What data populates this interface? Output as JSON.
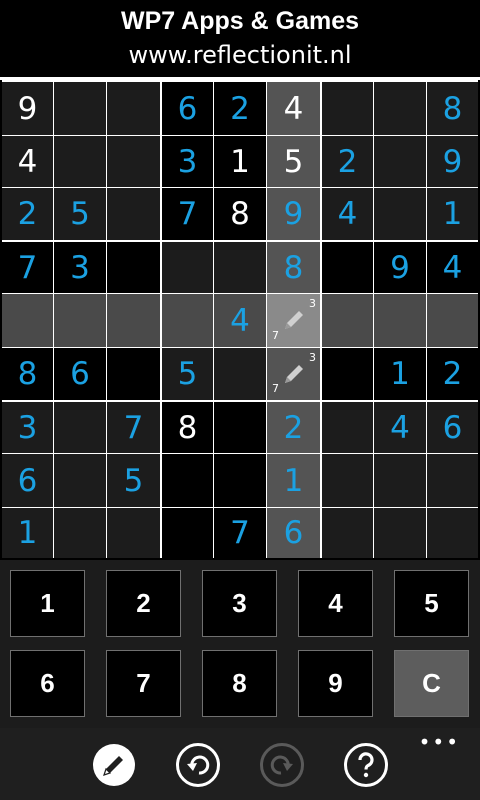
{
  "header": {
    "title": "WP7 Apps & Games",
    "subtitle": "www.reflectionit.nl"
  },
  "colors": {
    "given_digit": "#ffffff",
    "entered_digit": "#1ba1e2",
    "cell_default": "#1c1c1c",
    "cell_black": "#000000",
    "highlight_row": "#4a4a4a",
    "highlight_col": "#545454",
    "selected_cell": "#8a8a8a",
    "keypad_bg": "#1c1c1c",
    "appbar_bg": "#1f1f1f"
  },
  "board": {
    "selected": {
      "row": 4,
      "col": 5
    },
    "rows": [
      [
        {
          "v": "9",
          "t": "given"
        },
        {
          "v": "",
          "t": ""
        },
        {
          "v": "",
          "t": ""
        },
        {
          "v": "6",
          "t": "entered"
        },
        {
          "v": "2",
          "t": "entered"
        },
        {
          "v": "4",
          "t": "given"
        },
        {
          "v": "",
          "t": ""
        },
        {
          "v": "",
          "t": ""
        },
        {
          "v": "8",
          "t": "entered"
        }
      ],
      [
        {
          "v": "4",
          "t": "given"
        },
        {
          "v": "",
          "t": ""
        },
        {
          "v": "",
          "t": ""
        },
        {
          "v": "3",
          "t": "entered"
        },
        {
          "v": "1",
          "t": "given"
        },
        {
          "v": "5",
          "t": "given"
        },
        {
          "v": "2",
          "t": "entered"
        },
        {
          "v": "",
          "t": ""
        },
        {
          "v": "9",
          "t": "entered"
        }
      ],
      [
        {
          "v": "2",
          "t": "entered"
        },
        {
          "v": "5",
          "t": "entered"
        },
        {
          "v": "",
          "t": ""
        },
        {
          "v": "7",
          "t": "entered"
        },
        {
          "v": "8",
          "t": "given"
        },
        {
          "v": "9",
          "t": "entered"
        },
        {
          "v": "4",
          "t": "entered"
        },
        {
          "v": "",
          "t": ""
        },
        {
          "v": "1",
          "t": "entered"
        }
      ],
      [
        {
          "v": "7",
          "t": "entered"
        },
        {
          "v": "3",
          "t": "entered"
        },
        {
          "v": "",
          "t": ""
        },
        {
          "v": "",
          "t": ""
        },
        {
          "v": "",
          "t": ""
        },
        {
          "v": "8",
          "t": "entered"
        },
        {
          "v": "",
          "t": ""
        },
        {
          "v": "9",
          "t": "entered"
        },
        {
          "v": "4",
          "t": "entered"
        }
      ],
      [
        {
          "v": "",
          "t": ""
        },
        {
          "v": "",
          "t": ""
        },
        {
          "v": "",
          "t": ""
        },
        {
          "v": "",
          "t": ""
        },
        {
          "v": "4",
          "t": "entered"
        },
        {
          "v": "",
          "t": "notes",
          "notes": [
            "3",
            "7"
          ]
        },
        {
          "v": "",
          "t": ""
        },
        {
          "v": "",
          "t": ""
        },
        {
          "v": "",
          "t": ""
        }
      ],
      [
        {
          "v": "8",
          "t": "entered"
        },
        {
          "v": "6",
          "t": "entered"
        },
        {
          "v": "",
          "t": ""
        },
        {
          "v": "5",
          "t": "entered"
        },
        {
          "v": "",
          "t": ""
        },
        {
          "v": "",
          "t": "notes",
          "notes": [
            "3",
            "7"
          ]
        },
        {
          "v": "",
          "t": ""
        },
        {
          "v": "1",
          "t": "entered"
        },
        {
          "v": "2",
          "t": "entered"
        }
      ],
      [
        {
          "v": "3",
          "t": "entered"
        },
        {
          "v": "",
          "t": ""
        },
        {
          "v": "7",
          "t": "entered"
        },
        {
          "v": "8",
          "t": "given"
        },
        {
          "v": "",
          "t": ""
        },
        {
          "v": "2",
          "t": "entered"
        },
        {
          "v": "",
          "t": ""
        },
        {
          "v": "4",
          "t": "entered"
        },
        {
          "v": "6",
          "t": "entered"
        }
      ],
      [
        {
          "v": "6",
          "t": "entered"
        },
        {
          "v": "",
          "t": ""
        },
        {
          "v": "5",
          "t": "entered"
        },
        {
          "v": "",
          "t": ""
        },
        {
          "v": "",
          "t": ""
        },
        {
          "v": "1",
          "t": "entered"
        },
        {
          "v": "",
          "t": ""
        },
        {
          "v": "",
          "t": ""
        },
        {
          "v": "",
          "t": ""
        }
      ],
      [
        {
          "v": "1",
          "t": "entered"
        },
        {
          "v": "",
          "t": ""
        },
        {
          "v": "",
          "t": ""
        },
        {
          "v": "",
          "t": ""
        },
        {
          "v": "7",
          "t": "entered"
        },
        {
          "v": "6",
          "t": "entered"
        },
        {
          "v": "",
          "t": ""
        },
        {
          "v": "",
          "t": ""
        },
        {
          "v": "",
          "t": ""
        }
      ]
    ]
  },
  "keypad": {
    "keys": [
      "1",
      "2",
      "3",
      "4",
      "5",
      "6",
      "7",
      "8",
      "9",
      "C"
    ]
  },
  "appbar": {
    "buttons": [
      {
        "name": "pencil-mode-button",
        "icon": "pencil-icon",
        "state": "active"
      },
      {
        "name": "undo-button",
        "icon": "undo-icon",
        "state": "enabled"
      },
      {
        "name": "redo-button",
        "icon": "redo-icon",
        "state": "disabled"
      },
      {
        "name": "help-button",
        "icon": "help-icon",
        "state": "enabled"
      }
    ],
    "more_label": "•••"
  }
}
